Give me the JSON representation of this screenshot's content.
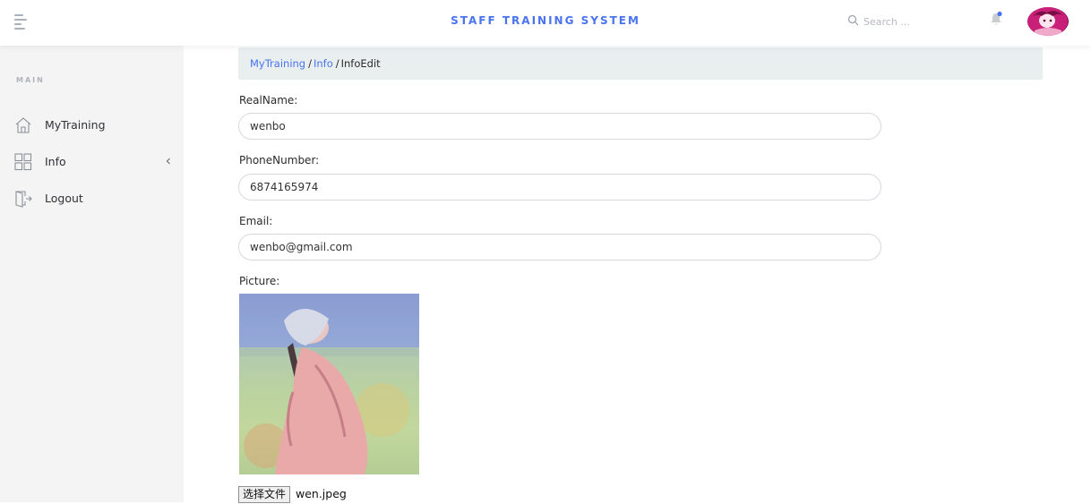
{
  "header": {
    "title": "STAFF TRAINING SYSTEM",
    "search_placeholder": "Search ...",
    "accent_color": "#4a73f0"
  },
  "sidebar": {
    "section_label": "MAIN",
    "items": [
      {
        "label": "MyTraining",
        "icon": "home-icon"
      },
      {
        "label": "Info",
        "icon": "grid-icon",
        "has_submenu": true
      },
      {
        "label": "Logout",
        "icon": "logout-icon"
      }
    ]
  },
  "breadcrumb": {
    "items": [
      "MyTraining",
      "Info",
      "InfoEdit"
    ],
    "separator": "/"
  },
  "form": {
    "real_name": {
      "label": "RealName:",
      "value": "wenbo"
    },
    "phone": {
      "label": "PhoneNumber:",
      "value": "6874165974"
    },
    "email": {
      "label": "Email:",
      "value": "wenbo@gmail.com"
    },
    "picture": {
      "label": "Picture:",
      "file_button_label": "选择文件",
      "file_name": "wen.jpeg"
    }
  }
}
